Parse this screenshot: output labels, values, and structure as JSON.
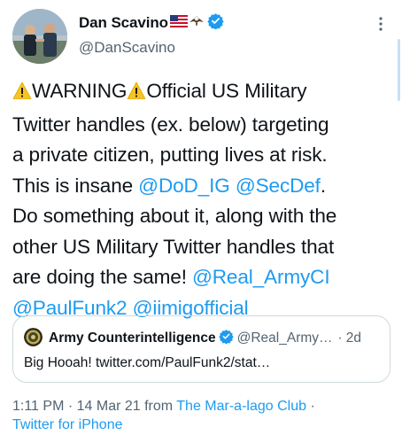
{
  "author": {
    "display_name": "Dan Scavino",
    "flag_emoji": "us-flag-icon",
    "eagle_emoji": "eagle-icon",
    "handle": "@DanScavino",
    "verified": true
  },
  "tweet": {
    "segments": [
      [
        "warning-icon",
        "WARNING",
        "warning-icon",
        "Official US Military"
      ],
      [
        "Twitter handles (ex. below) targeting"
      ],
      [
        "a private citizen, putting lives at risk."
      ],
      [
        "This is insane ",
        "@DoD_IG",
        " ",
        "@SecDef",
        "."
      ],
      [
        "Do something about it, along with the"
      ],
      [
        "other US Military Twitter handles that"
      ],
      [
        "are doing the same! ",
        "@Real_ArmyCI"
      ],
      [
        "@PaulFunk2",
        " ",
        "@iimigofficial"
      ]
    ],
    "line1_warning": "WARNING",
    "line1_rest": "Official US Military",
    "line2": "Twitter handles (ex. below) targeting",
    "line3": "a private citizen, putting lives at risk.",
    "line4_text": "This is insane ",
    "mention_dod_ig": "@DoD_IG",
    "mention_secdef": "@SecDef",
    "line4_end": ".",
    "line5": "Do something about it, along with the",
    "line6": "other US Military Twitter handles that",
    "line7_text": "are doing the same! ",
    "mention_real_armyci": "@Real_ArmyCI",
    "mention_paulfunk2": "@PaulFunk2",
    "mention_iimigofficial": "@iimigofficial"
  },
  "quote": {
    "name": "Army Counterintelligence",
    "handle": "@Real_Army…",
    "separator": "·",
    "time": "2d",
    "text": "Big Hooah! twitter.com/PaulFunk2/stat…",
    "verified": true
  },
  "meta": {
    "time_date": "1:11 PM · 14 Mar 21 from ",
    "source": "The Mar-a-lago Club",
    "trail": " ·",
    "client": "Twitter for iPhone"
  },
  "colors": {
    "link": "#1d9bf0",
    "secondary": "#536471",
    "verified": "#1d9bf0",
    "warning": "#f7c325"
  }
}
